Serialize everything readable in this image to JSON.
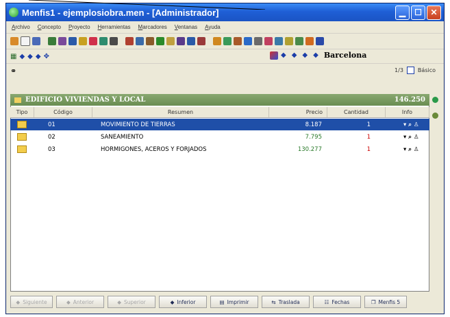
{
  "window": {
    "title": "Menfis1 - ejemplosiobra.men - [Administrador]"
  },
  "menu": [
    "Archivo",
    "Concepto",
    "Proyecto",
    "Herramientas",
    "Marcadores",
    "Ventanas",
    "Ayuda"
  ],
  "navigation": {
    "location": "Barcelona"
  },
  "pager": {
    "position": "1/3",
    "option_label": "Básico"
  },
  "chapter": {
    "title": "EDIFICIO VIVIENDAS Y LOCAL",
    "total": "146.250"
  },
  "table": {
    "columns": [
      "Tipo",
      "Código",
      "Resumen",
      "Precio",
      "Cantidad",
      "Info"
    ],
    "rows": [
      {
        "code": "01",
        "summary": "MOVIMIENTO DE TIERRAS",
        "price": "8.187",
        "quantity": "1",
        "selected": true
      },
      {
        "code": "02",
        "summary": "SANEAMIENTO",
        "price": "7.795",
        "quantity": "1",
        "selected": false
      },
      {
        "code": "03",
        "summary": "HORMIGONES, ACEROS Y FORJADOS",
        "price": "130.277",
        "quantity": "1",
        "selected": false
      }
    ]
  },
  "bottom_buttons": [
    {
      "label": "Siguiente",
      "icon": "arrow-left-icon",
      "enabled": false
    },
    {
      "label": "Anterior",
      "icon": "arrow-left-icon",
      "enabled": false
    },
    {
      "label": "Superior",
      "icon": "arrow-up-icon",
      "enabled": false
    },
    {
      "label": "Inferior",
      "icon": "arrow-down-icon",
      "enabled": true
    },
    {
      "label": "Imprimir",
      "icon": "printer-icon",
      "enabled": true
    },
    {
      "label": "Traslada",
      "icon": "transfer-icon",
      "enabled": true
    },
    {
      "label": "Fechas",
      "icon": "dates-icon",
      "enabled": true
    },
    {
      "label": "Menfis 5",
      "icon": "window-icon",
      "enabled": true
    }
  ],
  "colors": {
    "titlebar": "#1f5fd6",
    "chapter_bar": "#6a8d52",
    "selected_row": "#1f4fa8",
    "price_text": "#2a7a2a",
    "quantity_text": "#cc0000"
  }
}
